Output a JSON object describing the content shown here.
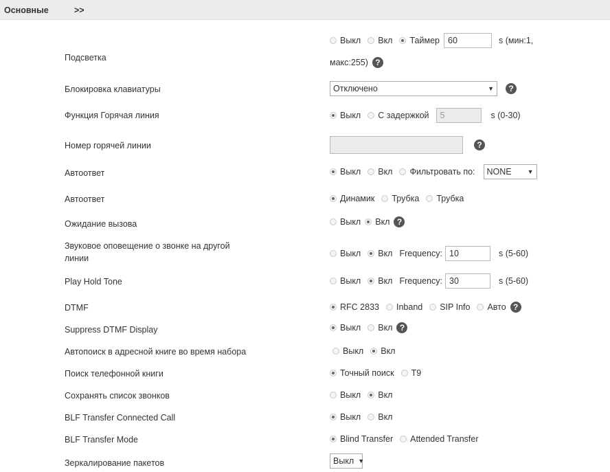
{
  "header": {
    "title": "Основные",
    "arrow": ">>"
  },
  "rows": {
    "backlight": {
      "label": "Подсветка",
      "opt_off": "Выкл",
      "opt_on": "Вкл",
      "opt_timer": "Таймер",
      "timer_value": "60",
      "unit_line1": "s (мин:1,",
      "unit_line2": "макс:255)"
    },
    "keylock": {
      "label": "Блокировка клавиатуры",
      "select_value": "Отключено"
    },
    "hotline": {
      "label": "Функция Горячая линия",
      "opt_off": "Выкл",
      "opt_delay": "С задержкой",
      "delay_value": "5",
      "unit": "s (0-30)"
    },
    "hotline_number": {
      "label": "Номер горячей линии",
      "value": ""
    },
    "autoanswer1": {
      "label": "Автоответ",
      "opt_off": "Выкл",
      "opt_on": "Вкл",
      "opt_filter": "Фильтровать по:",
      "filter_value": "NONE"
    },
    "autoanswer2": {
      "label": "Автоответ",
      "opt_speaker": "Динамик",
      "opt_handset1": "Трубка",
      "opt_handset2": "Трубка"
    },
    "callwaiting": {
      "label": "Ожидание вызова",
      "opt_off": "Выкл",
      "opt_on": "Вкл"
    },
    "callwaiting_tone": {
      "label_line1": "Звуковое оповещение о звонке на другой",
      "label_line2": "линии",
      "opt_off": "Выкл",
      "opt_on": "Вкл",
      "freq_label": "Frequency:",
      "freq_value": "10",
      "unit": "s (5-60)"
    },
    "hold_tone": {
      "label": "Play Hold Tone",
      "opt_off": "Выкл",
      "opt_on": "Вкл",
      "freq_label": "Frequency:",
      "freq_value": "30",
      "unit": "s (5-60)"
    },
    "dtmf": {
      "label": "DTMF",
      "opt_rfc": "RFC 2833",
      "opt_inband": "Inband",
      "opt_sip": "SIP Info",
      "opt_auto": "Авто"
    },
    "suppress_dtmf": {
      "label": "Suppress DTMF Display",
      "opt_off": "Выкл",
      "opt_on": "Вкл"
    },
    "autosearch": {
      "label": "Автопоиск в адресной книге во время набора",
      "opt_off": "Выкл",
      "opt_on": "Вкл"
    },
    "phonebook_search": {
      "label": "Поиск телефонной книги",
      "opt_exact": "Точный поиск",
      "opt_t9": "T9"
    },
    "save_calllog": {
      "label": "Сохранять список звонков",
      "opt_off": "Выкл",
      "opt_on": "Вкл"
    },
    "blf_connected": {
      "label": "BLF Transfer Connected Call",
      "opt_off": "Выкл",
      "opt_on": "Вкл"
    },
    "blf_mode": {
      "label": "BLF Transfer Mode",
      "opt_blind": "Blind Transfer",
      "opt_attended": "Attended Transfer"
    },
    "mirroring": {
      "label": "Зеркалирование пакетов",
      "select_value": "Выкл"
    }
  },
  "help_glyph": "?",
  "caret_glyph": "▼"
}
